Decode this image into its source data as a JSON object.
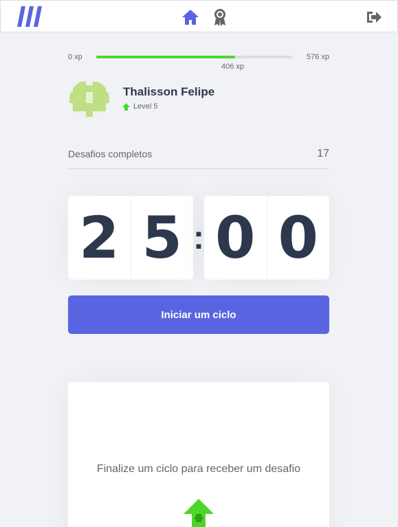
{
  "header": {
    "logo_icon": "move-it-logo",
    "nav": [
      {
        "name": "home",
        "icon": "home-icon",
        "active": true
      },
      {
        "name": "leaderboard",
        "icon": "award-icon",
        "active": false
      }
    ],
    "logout_icon": "logout-icon"
  },
  "experience": {
    "min_label": "0 xp",
    "max_label": "576 xp",
    "current_label": "406 xp",
    "progress_fraction": 0.705
  },
  "profile": {
    "name": "Thalisson Felipe",
    "level_label": "Level 5"
  },
  "completed_challenges": {
    "label": "Desafios completos",
    "count": "17"
  },
  "countdown": {
    "minute_left": "2",
    "minute_right": "5",
    "separator": ":",
    "second_left": "0",
    "second_right": "0"
  },
  "start_button": {
    "label": "Iniciar um ciclo"
  },
  "challenge_box": {
    "message": "Finalize um ciclo para receber um desafio",
    "icon": "level-up-icon"
  },
  "colors": {
    "accent": "#5965e0",
    "green": "#4cd62b",
    "background": "#f1f2f5",
    "title": "#2e384d",
    "text": "#666666"
  }
}
